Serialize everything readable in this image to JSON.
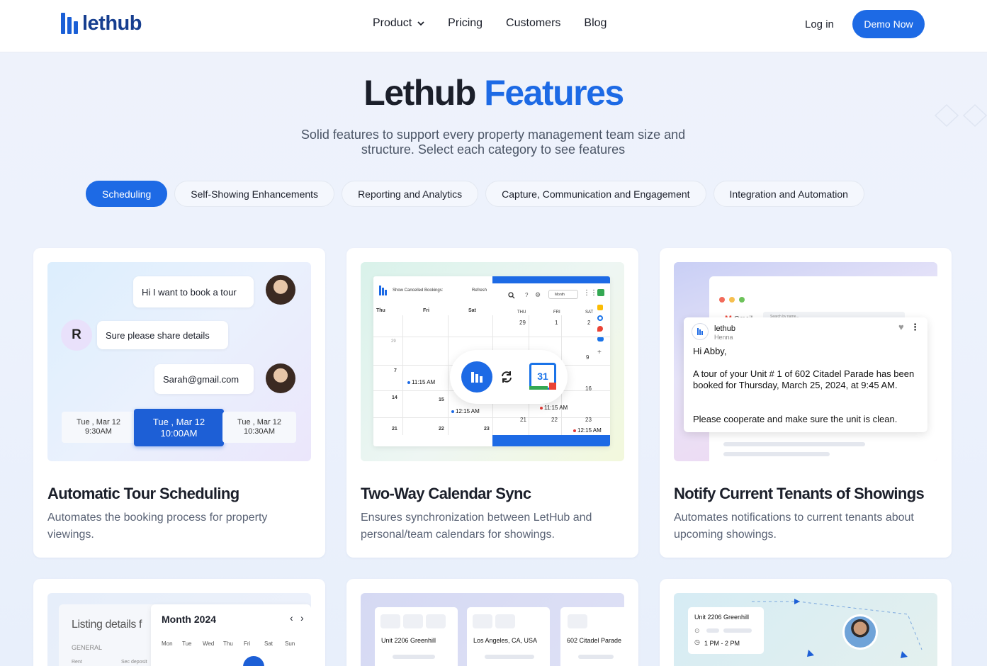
{
  "header": {
    "logo_text": "lethub",
    "nav": [
      "Product",
      "Pricing",
      "Customers",
      "Blog"
    ],
    "login": "Log in",
    "demo": "Demo Now"
  },
  "hero": {
    "title_dark": "Lethub",
    "title_accent": "Features",
    "subtitle": "Solid features to support every property management team size and structure. Select each category to see features"
  },
  "tabs": [
    "Scheduling",
    "Self-Showing Enhancements",
    "Reporting and Analytics",
    "Capture, Communication and Engagement",
    "Integration and Automation"
  ],
  "active_tab": "Scheduling",
  "colors": {
    "accent": "#1d6ae5",
    "brand_dark": "#163e8f"
  },
  "cards": [
    {
      "title": "Automatic Tour Scheduling",
      "desc": "Automates the booking process for property viewings.",
      "chat": {
        "msg1": "Hi I want to book a tour",
        "avatar_letter": "R",
        "msg2": "Sure please share details",
        "msg3": "Sarah@gmail.com"
      },
      "slots": [
        {
          "day": "Tue , Mar 12",
          "time": "9:30AM"
        },
        {
          "day": "Tue , Mar 12",
          "time": "10:00AM"
        },
        {
          "day": "Tue , Mar 12",
          "time": "10:30AM"
        }
      ]
    },
    {
      "title": "Two-Way Calendar Sync",
      "desc": "Ensures synchronization between LetHub and personal/team calendars for showings.",
      "calendar": {
        "show_cancelled": "Show Cancelled Bookings:",
        "refresh": "Refresh",
        "month_btn": "Month",
        "left_days": [
          "Thu",
          "Fri",
          "Sat"
        ],
        "right_days": [
          {
            "name": "THU",
            "num": "29"
          },
          {
            "name": "FRI",
            "num": "1"
          },
          {
            "name": "SAT",
            "num": "2"
          }
        ],
        "gcal_num": "31",
        "left_dates": [
          "29",
          "7",
          "14",
          "15",
          "16",
          "21",
          "22",
          "23"
        ],
        "right_dates": [
          "9",
          "14",
          "15",
          "16",
          "21",
          "22",
          "23"
        ],
        "events": [
          "11:15 AM",
          "12:15 AM",
          "11:15 AM",
          "12:15 AM"
        ]
      }
    },
    {
      "title": "Notify Current Tenants of Showings",
      "desc": "Automates notifications to current tenants about upcoming showings.",
      "mail": {
        "app": "Gmail",
        "search": "Search by name...",
        "sender": "lethub",
        "sub_sender": "Henna",
        "greeting": "Hi Abby,",
        "body1": "A tour of your Unit # 1 of 602 Citadel Parade has been booked for Thursday, March 25, 2024, at 9:45 AM.",
        "body2": "Please cooperate and make sure the unit is clean."
      }
    }
  ],
  "teasers": {
    "listing": {
      "title": "Listing details f",
      "general": "GENERAL",
      "rent": "Rent",
      "sec_deposit": "Sec deposit",
      "month_title": "Month 2024",
      "weekdays": [
        "Mon",
        "Tue",
        "Wed",
        "Thu",
        "Fri",
        "Sat",
        "Sun"
      ]
    },
    "properties": [
      "Unit 2206 Greenhill",
      "Los Angeles, CA, USA",
      "602 Citadel Parade"
    ],
    "route": {
      "unit": "Unit 2206 Greenhill",
      "time": "1 PM - 2 PM"
    }
  }
}
